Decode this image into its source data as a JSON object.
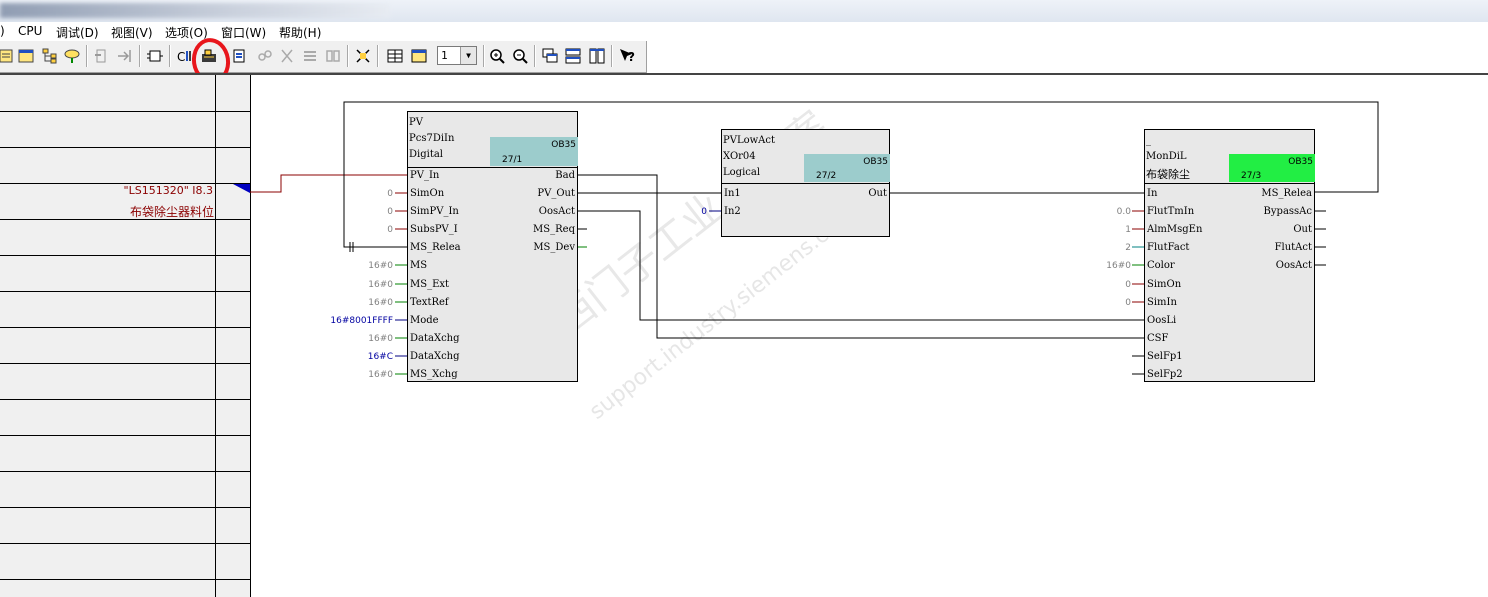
{
  "menu": [
    {
      "label": ")"
    },
    {
      "label": "CPU"
    },
    {
      "label": "调试(D)"
    },
    {
      "label": "视图(V)"
    },
    {
      "label": "选项(O)"
    },
    {
      "label": "窗口(W)"
    },
    {
      "label": "帮助(H)"
    }
  ],
  "toolbar": {
    "zoom_value": "1",
    "icons": [
      "compile-icon",
      "open-icon",
      "tree-icon",
      "display-icon",
      "insert-icon",
      "jump-icon",
      "block-icon",
      "connect-icon",
      "test-mode-icon",
      "monitor-icon",
      "unlink-icon",
      "cut-icon",
      "list-icon",
      "address-icon",
      "overview-icon",
      "table-icon",
      "sheet-icon",
      "zoom-in-icon",
      "zoom-out-icon",
      "cascade-icon",
      "tile-h-icon",
      "tile-v-icon",
      "help-icon"
    ],
    "highlight_color": "#e8161c"
  },
  "sheetbar": {
    "external_address": "\"LS151320\" I8.3",
    "external_comment": "布袋除尘器料位",
    "color": "#8b0000"
  },
  "blocks": {
    "pv": {
      "name": "PV",
      "type": "Pcs7DiIn",
      "comment": "Digital",
      "ob": "OB35",
      "seq": "27/1",
      "ob_color": "#9ccccc",
      "inputs": [
        {
          "pin": "PV_In",
          "value": ""
        },
        {
          "pin": "SimOn",
          "value": "0"
        },
        {
          "pin": "SimPV_In",
          "value": "0"
        },
        {
          "pin": "SubsPV_I",
          "value": "0"
        },
        {
          "pin": "MS_Relea",
          "value": ""
        },
        {
          "pin": "MS",
          "value": "16#0"
        },
        {
          "pin": "MS_Ext",
          "value": "16#0"
        },
        {
          "pin": "TextRef",
          "value": "16#0"
        },
        {
          "pin": "Mode",
          "value": "16#8001FFFF"
        },
        {
          "pin": "DataXchg",
          "value": "16#0"
        },
        {
          "pin": "DataXchg",
          "value": "16#C"
        },
        {
          "pin": "MS_Xchg",
          "value": "16#0"
        }
      ],
      "outputs": [
        {
          "pin": "Bad"
        },
        {
          "pin": "PV_Out"
        },
        {
          "pin": "OosAct"
        },
        {
          "pin": "MS_Req"
        },
        {
          "pin": "MS_Dev"
        }
      ]
    },
    "pvlow": {
      "name": "PVLowAct",
      "type": "XOr04",
      "comment": "Logical",
      "ob": "OB35",
      "seq": "27/2",
      "ob_color": "#9ccccc",
      "inputs": [
        {
          "pin": "In1",
          "value": ""
        },
        {
          "pin": "In2",
          "value": "0"
        }
      ],
      "outputs": [
        {
          "pin": "Out"
        }
      ]
    },
    "mon": {
      "name": "_",
      "type": "MonDiL",
      "comment": "布袋除尘",
      "ob": "OB35",
      "seq": "27/3",
      "ob_color": "#22ee44",
      "inputs": [
        {
          "pin": "In",
          "value": ""
        },
        {
          "pin": "FlutTmIn",
          "value": "0.0"
        },
        {
          "pin": "AlmMsgEn",
          "value": "1"
        },
        {
          "pin": "FlutFact",
          "value": "2"
        },
        {
          "pin": "Color",
          "value": "16#0"
        },
        {
          "pin": "SimOn",
          "value": "0"
        },
        {
          "pin": "SimIn",
          "value": "0"
        },
        {
          "pin": "OosLi",
          "value": ""
        },
        {
          "pin": "CSF",
          "value": ""
        },
        {
          "pin": "SelFp1",
          "value": ""
        },
        {
          "pin": "SelFp2",
          "value": ""
        }
      ],
      "outputs": [
        {
          "pin": "MS_Relea"
        },
        {
          "pin": "BypassAc"
        },
        {
          "pin": "Out"
        },
        {
          "pin": "FlutAct"
        },
        {
          "pin": "OosAct"
        }
      ]
    }
  },
  "watermark": {
    "text_cn": "西门子工业  找答案",
    "text_url": "support.industry.siemens.com/cs"
  }
}
